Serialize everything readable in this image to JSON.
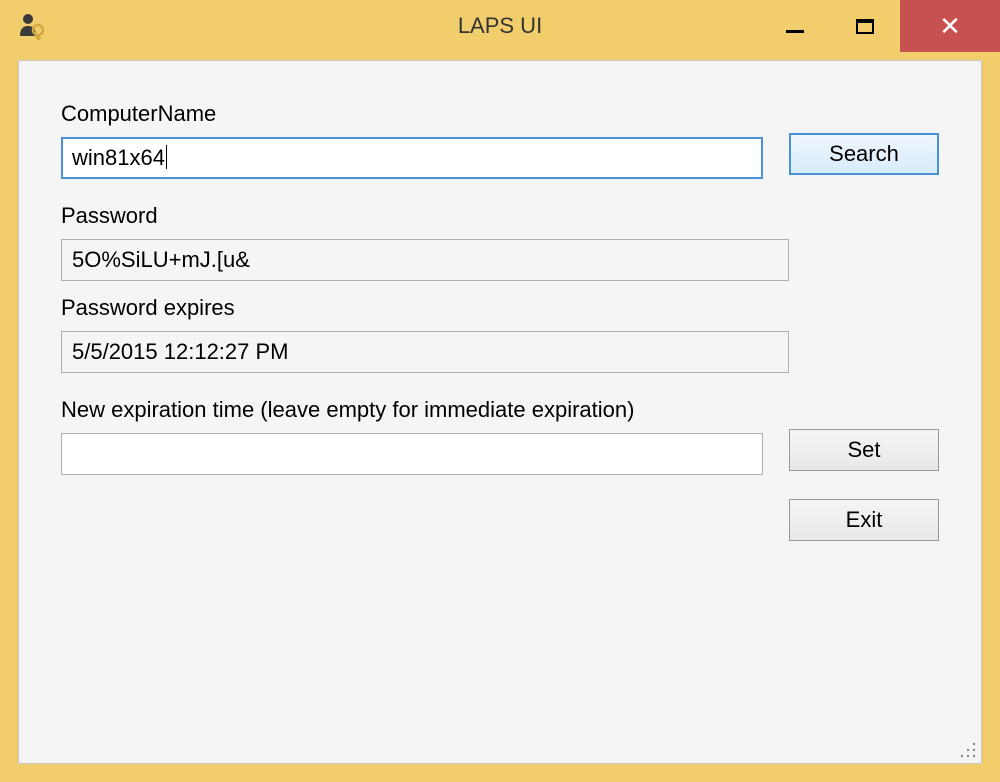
{
  "window": {
    "title": "LAPS UI"
  },
  "labels": {
    "computer_name": "ComputerName",
    "password": "Password",
    "password_expires": "Password expires",
    "new_expiration": "New expiration time (leave empty for immediate expiration)"
  },
  "values": {
    "computer_name": "win81x64",
    "password": "5O%SiLU+mJ.[u&",
    "password_expires": "5/5/2015 12:12:27 PM",
    "new_expiration": ""
  },
  "buttons": {
    "search": "Search",
    "set": "Set",
    "exit": "Exit"
  },
  "colors": {
    "title_bg": "#f2cd6c",
    "close_btn": "#c75050",
    "focus_border": "#4a90d9",
    "client_bg": "#f5f5f5"
  }
}
